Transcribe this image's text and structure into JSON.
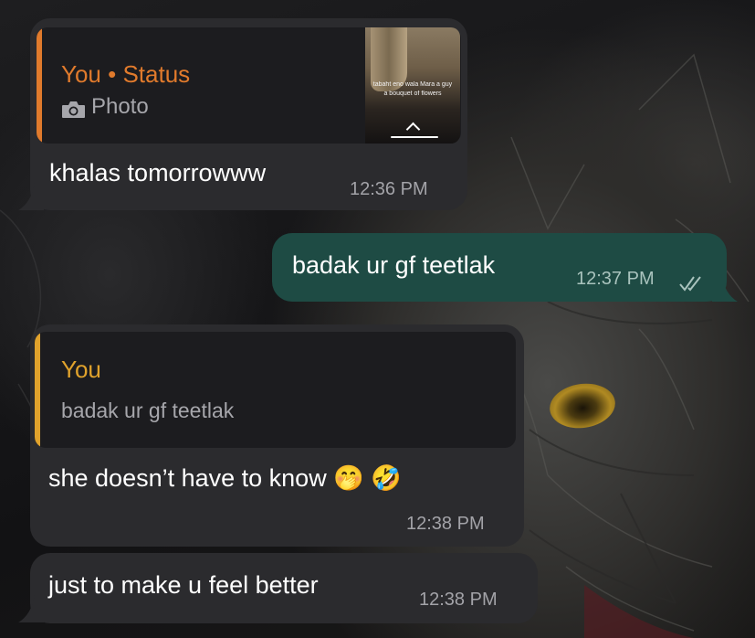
{
  "messages": [
    {
      "direction": "incoming",
      "quote": {
        "sender": "You",
        "separator": "•",
        "context": "Status",
        "media_icon": "camera-icon",
        "media_label": "Photo",
        "accent_color": "#e07a2c",
        "thumbnail": {
          "caption_line1": "tabaht eno wala Mara a guy",
          "caption_line2": "a bouquet of flowers",
          "reply_label": "Reply"
        }
      },
      "text": "khalas tomorrowww",
      "time": "12:36 PM"
    },
    {
      "direction": "outgoing",
      "text": "badak ur gf teetlak",
      "time": "12:37 PM",
      "status_icon": "double-check-icon"
    },
    {
      "direction": "incoming",
      "quote": {
        "sender": "You",
        "text": "badak ur gf teetlak",
        "accent_color": "#e0a22c"
      },
      "text": "she doesn’t have to know 🤭 🤣",
      "time": "12:38 PM"
    },
    {
      "direction": "incoming",
      "text": "just to make u feel better",
      "time": "12:38 PM"
    }
  ],
  "colors": {
    "incoming_bubble": "#2b2b2e",
    "outgoing_bubble": "#1e4b44",
    "quote_background": "#1c1c1f",
    "status_sender": "#e07a2c",
    "reply_sender": "#e0a22c"
  },
  "wallpaper": "dark photo of a tabby cat"
}
